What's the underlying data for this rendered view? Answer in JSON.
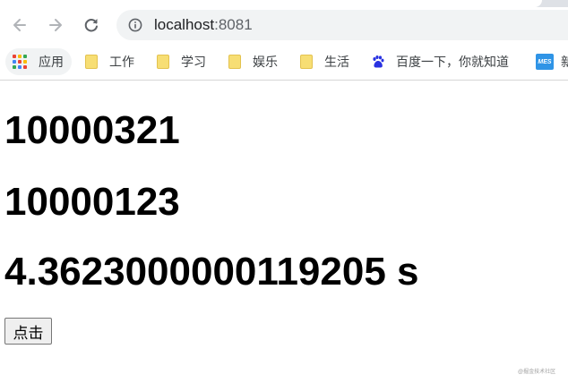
{
  "browser": {
    "url_host": "localhost",
    "url_port": ":8081",
    "colors": {
      "chrome_bg": "#dee1e6",
      "omnibox_bg": "#f1f3f4",
      "folder": "#f7de74",
      "baidu": "#2932e1",
      "mes": "#2f94e6"
    }
  },
  "bookmarks": {
    "apps_label": "应用",
    "items": [
      {
        "label": "工作",
        "icon": "folder-icon"
      },
      {
        "label": "学习",
        "icon": "folder-icon"
      },
      {
        "label": "娱乐",
        "icon": "folder-icon"
      },
      {
        "label": "生活",
        "icon": "folder-icon"
      },
      {
        "label": "百度一下，你就知道",
        "icon": "baidu-paw-icon"
      },
      {
        "label": "新",
        "icon": "mes-icon"
      }
    ],
    "mes_icon_text": "MES"
  },
  "page": {
    "line1": "10000321",
    "line2": "10000123",
    "line3": "4.3623000000119205 s",
    "button_label": "点击"
  },
  "watermark": "@掘金技术社区"
}
